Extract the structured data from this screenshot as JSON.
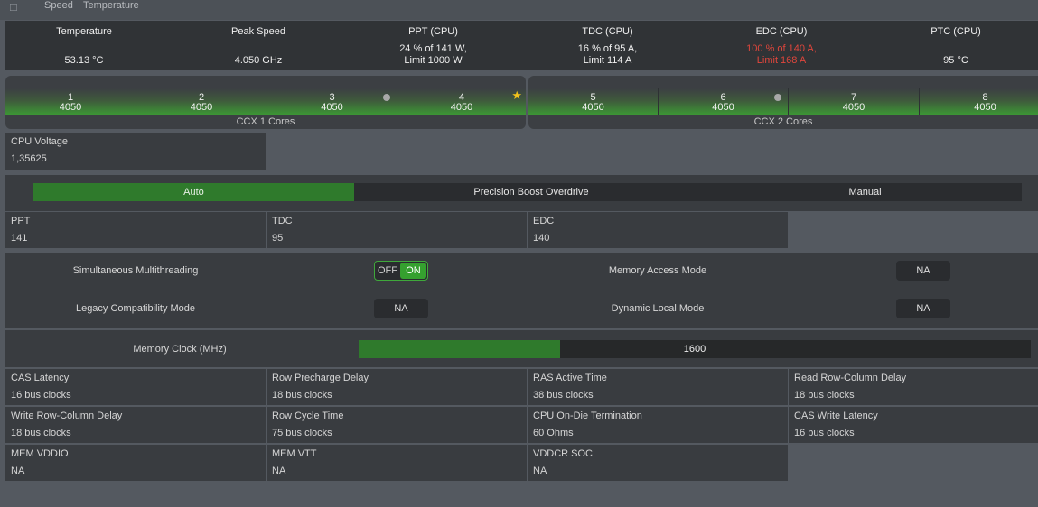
{
  "topbar": {
    "tabs": [
      "Speed",
      "Temperature"
    ]
  },
  "stats": [
    {
      "label": "Temperature",
      "value": "53.13 °C"
    },
    {
      "label": "Peak Speed",
      "value": "4.050  GHz"
    },
    {
      "label": "PPT (CPU)",
      "line1": "24 % of 141 W,",
      "line2": "Limit 1000 W"
    },
    {
      "label": "TDC (CPU)",
      "line1": "16 % of 95 A,",
      "line2": "Limit 114 A"
    },
    {
      "label": "EDC (CPU)",
      "line1": "100 % of 140 A,",
      "line2": "Limit 168 A",
      "alert_color": "#e0463c"
    },
    {
      "label": "PTC (CPU)",
      "value": "95 °C"
    }
  ],
  "ccx": [
    {
      "label": "CCX 1 Cores",
      "cores": [
        {
          "num": "1",
          "freq": "4050",
          "marker": ""
        },
        {
          "num": "2",
          "freq": "4050",
          "marker": ""
        },
        {
          "num": "3",
          "freq": "4050",
          "marker": "dot"
        },
        {
          "num": "4",
          "freq": "4050",
          "marker": "star"
        }
      ]
    },
    {
      "label": "CCX 2 Cores",
      "cores": [
        {
          "num": "5",
          "freq": "4050",
          "marker": ""
        },
        {
          "num": "6",
          "freq": "4050",
          "marker": "dot"
        },
        {
          "num": "7",
          "freq": "4050",
          "marker": ""
        },
        {
          "num": "8",
          "freq": "4050",
          "marker": ""
        }
      ]
    }
  ],
  "voltage": {
    "label": "CPU Voltage",
    "value": "1,35625"
  },
  "modes": {
    "options": [
      "Auto",
      "Precision Boost Overdrive",
      "Manual"
    ],
    "selected": "Auto",
    "accent": "#2f7a2c"
  },
  "limits": [
    {
      "label": "PPT",
      "value": "141"
    },
    {
      "label": "TDC",
      "value": "95"
    },
    {
      "label": "EDC",
      "value": "140"
    }
  ],
  "toggles": {
    "smt": {
      "label": "Simultaneous Multithreading",
      "off": "OFF",
      "on": "ON",
      "state": "on"
    },
    "memory_access": {
      "label": "Memory Access Mode",
      "value": "NA"
    },
    "legacy": {
      "label": "Legacy Compatibility Mode",
      "value": "NA"
    },
    "dynamic_local": {
      "label": "Dynamic Local Mode",
      "value": "NA"
    }
  },
  "memory_clock": {
    "label": "Memory Clock (MHz)",
    "value": "1600",
    "fill_fraction": 0.3
  },
  "timings": [
    [
      {
        "label": "CAS Latency",
        "value": "16 bus clocks"
      },
      {
        "label": "Row Precharge Delay",
        "value": "18 bus clocks"
      },
      {
        "label": "RAS Active Time",
        "value": "38 bus clocks"
      },
      {
        "label": "Read Row-Column Delay",
        "value": "18 bus clocks"
      }
    ],
    [
      {
        "label": "Write Row-Column Delay",
        "value": "18 bus clocks"
      },
      {
        "label": "Row Cycle Time",
        "value": "75 bus clocks"
      },
      {
        "label": "CPU On-Die Termination",
        "value": "60 Ohms"
      },
      {
        "label": "CAS Write Latency",
        "value": "16 bus clocks"
      }
    ],
    [
      {
        "label": "MEM VDDIO",
        "value": "NA"
      },
      {
        "label": "MEM VTT",
        "value": "NA"
      },
      {
        "label": "VDDCR SOC",
        "value": "NA"
      }
    ]
  ]
}
